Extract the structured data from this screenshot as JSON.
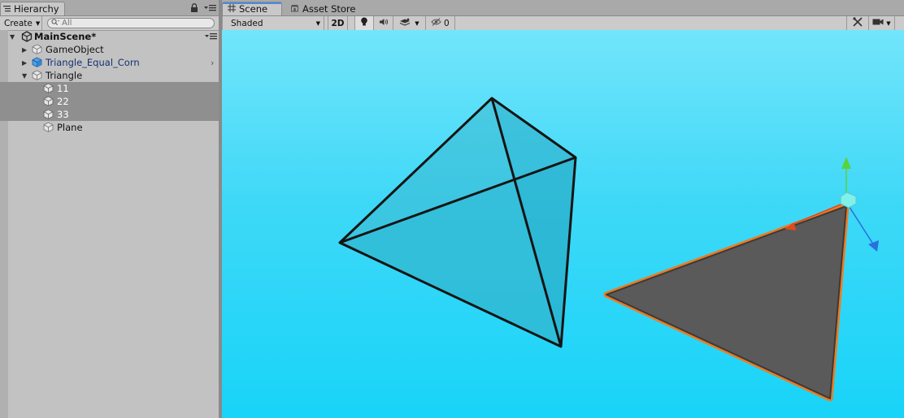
{
  "hierarchy": {
    "tab_label": "Hierarchy",
    "create_label": "Create",
    "search_placeholder": "All",
    "scene_name": "MainScene*",
    "items": [
      {
        "label": "GameObject",
        "depth": 1,
        "expander": "collapsed"
      },
      {
        "label": "Triangle_Equal_Corn",
        "depth": 1,
        "expander": "collapsed",
        "prefab": true
      },
      {
        "label": "Triangle",
        "depth": 1,
        "expander": "expanded"
      },
      {
        "label": "11",
        "depth": 2,
        "selected": true
      },
      {
        "label": "22",
        "depth": 2,
        "selected": true
      },
      {
        "label": "33",
        "depth": 2,
        "selected": true
      },
      {
        "label": "Plane",
        "depth": 2
      }
    ]
  },
  "scene": {
    "tabs": [
      {
        "label": "Scene",
        "active": true,
        "icon": "grid-icon"
      },
      {
        "label": "Asset Store",
        "active": false,
        "icon": "store-icon"
      }
    ],
    "toolbar": {
      "shading_mode": "Shaded",
      "mode_2d": "2D",
      "hidden_count": "0"
    }
  },
  "colors": {
    "selection_outline": "#f07a1e",
    "sky_top": "#72e5fb",
    "sky_bottom": "#18d4f8",
    "tetra_fill": "#3ab8d0",
    "plane_fill": "#5a5a5a",
    "gizmo_y": "#5ad23c",
    "gizmo_x": "#e04a1c",
    "gizmo_z": "#2a6fe0"
  }
}
